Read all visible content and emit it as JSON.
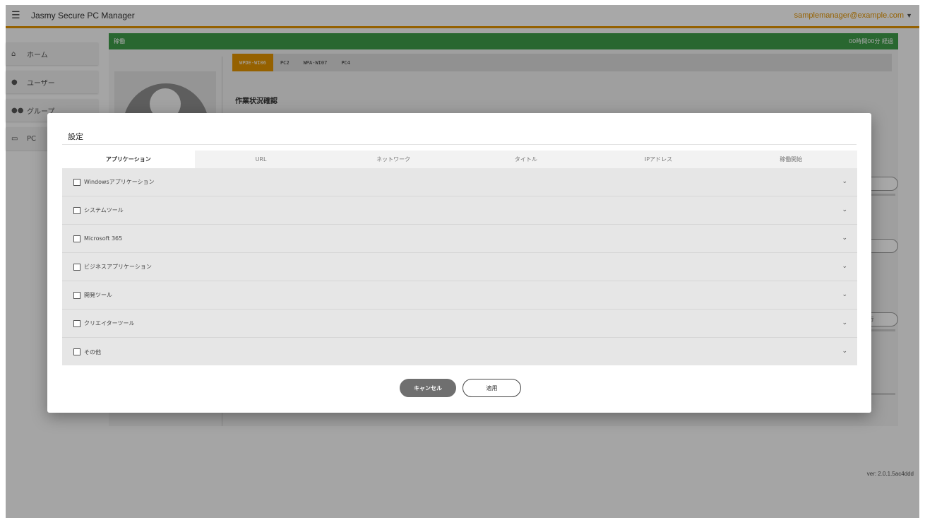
{
  "app": {
    "title": "Jasmy Secure PC Manager",
    "user_email": "samplemanager@example.com",
    "version": "ver: 2.0.1.5ac4ddd"
  },
  "sidebar": {
    "items": [
      {
        "label": "ホーム",
        "icon": "home-icon"
      },
      {
        "label": "ユーザー",
        "icon": "person-icon"
      },
      {
        "label": "グループ",
        "icon": "group-icon"
      },
      {
        "label": "PC",
        "icon": "laptop-icon"
      }
    ]
  },
  "status": {
    "label": "稼働",
    "elapsed": "00時間00分 経過"
  },
  "pc_tabs": [
    "WPDE-WI06",
    "PC2",
    "WPA-WI07",
    "PC4"
  ],
  "work_section": {
    "title": "作業状況確認"
  },
  "modal": {
    "title": "設定",
    "tabs": [
      "アプリケーション",
      "URL",
      "ネットワーク",
      "タイトル",
      "IPアドレス",
      "稼働開始"
    ],
    "active_tab": "アプリケーション",
    "categories": [
      "Windowsアプリケーション",
      "システムツール",
      "Microsoft 365",
      "ビジネスアプリケーション",
      "開発ツール",
      "クリエイターツール",
      "その他"
    ],
    "cancel_label": "キャンセル",
    "apply_label": "適用"
  },
  "colors": {
    "accent": "#e39400",
    "status_green": "#3f9d49",
    "cancel_button": "#6f6f6f"
  }
}
